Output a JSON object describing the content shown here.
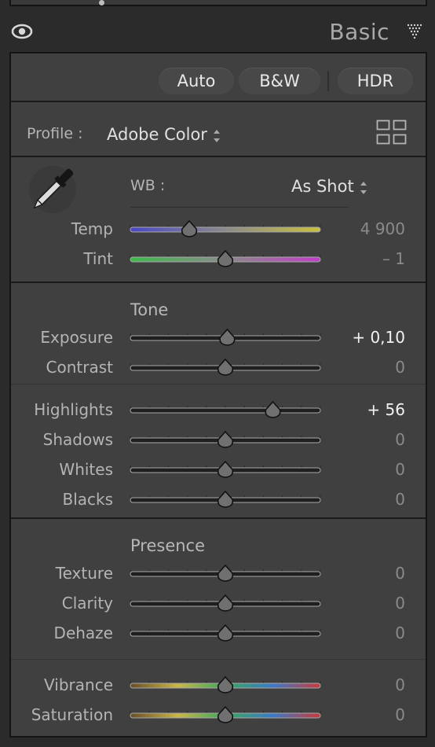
{
  "header": {
    "title": "Basic"
  },
  "toolbar": {
    "auto": "Auto",
    "bw": "B&W",
    "hdr": "HDR"
  },
  "profile": {
    "label": "Profile :",
    "value": "Adobe Color"
  },
  "wb": {
    "label": "WB :",
    "value": "As Shot"
  },
  "sections": {
    "tone": "Tone",
    "presence": "Presence"
  },
  "colors": {
    "panel": "#404040",
    "track_dark": "#1f1f1f",
    "temp_gradient": [
      "#4a48c8",
      "#8a8a8a",
      "#c9c13a"
    ],
    "tint_gradient": [
      "#3dbb4a",
      "#8a8a8a",
      "#c23ec7"
    ],
    "vibrance_gradient": [
      "#6a4d2a",
      "#c9b648",
      "#3aa85b",
      "#3b79c7",
      "#c73a3a"
    ]
  },
  "sliders": [
    {
      "key": "temp",
      "label": "Temp",
      "value_text": "4 900",
      "fraction": 0.31,
      "track": "temp"
    },
    {
      "key": "tint",
      "label": "Tint",
      "value_text": "– 1",
      "fraction": 0.5,
      "track": "tint"
    },
    {
      "key": "exposure",
      "label": "Exposure",
      "value_text": "+ 0,10",
      "fraction": 0.51,
      "track": "dark",
      "bright": true
    },
    {
      "key": "contrast",
      "label": "Contrast",
      "value_text": "0",
      "fraction": 0.5,
      "track": "dark"
    },
    {
      "key": "highlights",
      "label": "Highlights",
      "value_text": "+ 56",
      "fraction": 0.75,
      "track": "dark",
      "bright": true
    },
    {
      "key": "shadows",
      "label": "Shadows",
      "value_text": "0",
      "fraction": 0.5,
      "track": "dark"
    },
    {
      "key": "whites",
      "label": "Whites",
      "value_text": "0",
      "fraction": 0.5,
      "track": "dark"
    },
    {
      "key": "blacks",
      "label": "Blacks",
      "value_text": "0",
      "fraction": 0.5,
      "track": "dark"
    },
    {
      "key": "texture",
      "label": "Texture",
      "value_text": "0",
      "fraction": 0.5,
      "track": "dark"
    },
    {
      "key": "clarity",
      "label": "Clarity",
      "value_text": "0",
      "fraction": 0.5,
      "track": "dark"
    },
    {
      "key": "dehaze",
      "label": "Dehaze",
      "value_text": "0",
      "fraction": 0.5,
      "track": "dark"
    },
    {
      "key": "vibrance",
      "label": "Vibrance",
      "value_text": "0",
      "fraction": 0.5,
      "track": "vibrance"
    },
    {
      "key": "saturation",
      "label": "Saturation",
      "value_text": "0",
      "fraction": 0.5,
      "track": "vibrance"
    }
  ]
}
